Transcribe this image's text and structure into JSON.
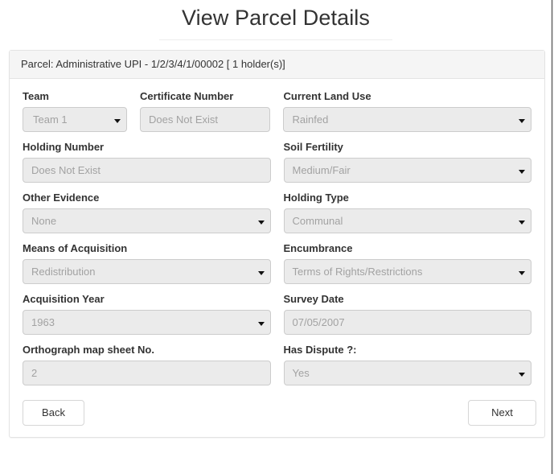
{
  "page": {
    "title": "View Parcel Details"
  },
  "panel": {
    "heading": "Parcel: Administrative UPI - 1/2/3/4/1/00002 [ 1 holder(s)]"
  },
  "form": {
    "rows": [
      {
        "left_pair": [
          {
            "label": "Team",
            "value": "Team 1",
            "control": "select",
            "name": "team"
          },
          {
            "label": "Certificate Number",
            "value": "Does Not Exist",
            "control": "input",
            "name": "certificate-number"
          }
        ],
        "right": {
          "label": "Current Land Use",
          "value": "Rainfed",
          "control": "select",
          "name": "current-land-use"
        }
      },
      {
        "left": {
          "label": "Holding Number",
          "value": "Does Not Exist",
          "control": "input",
          "name": "holding-number"
        },
        "right": {
          "label": "Soil Fertility",
          "value": "Medium/Fair",
          "control": "select",
          "name": "soil-fertility"
        }
      },
      {
        "left": {
          "label": "Other Evidence",
          "value": "None",
          "control": "select",
          "name": "other-evidence"
        },
        "right": {
          "label": "Holding Type",
          "value": "Communal",
          "control": "select",
          "name": "holding-type"
        }
      },
      {
        "left": {
          "label": "Means of Acquisition",
          "value": "Redistribution",
          "control": "select",
          "name": "means-of-acquisition"
        },
        "right": {
          "label": "Encumbrance",
          "value": "Terms of Rights/Restrictions",
          "control": "select",
          "name": "encumbrance"
        }
      },
      {
        "left": {
          "label": "Acquisition Year",
          "value": "1963",
          "control": "select",
          "name": "acquisition-year"
        },
        "right": {
          "label": "Survey Date",
          "value": "07/05/2007",
          "control": "input",
          "name": "survey-date"
        }
      },
      {
        "left": {
          "label": "Orthograph map sheet No.",
          "value": "2",
          "control": "input",
          "name": "orthograph-map-sheet-no"
        },
        "right": {
          "label": "Has Dispute ?:",
          "value": "Yes",
          "control": "select",
          "name": "has-dispute"
        }
      }
    ]
  },
  "footer": {
    "back_label": "Back",
    "next_label": "Next"
  },
  "colors": {
    "page_background": "#ffffff",
    "panel_border": "#e3e3e3",
    "panel_heading_background": "#f5f5f5",
    "field_background": "#ebebeb",
    "field_border": "#cccccc",
    "field_text": "#a2a2a2",
    "label_text": "#333333"
  }
}
